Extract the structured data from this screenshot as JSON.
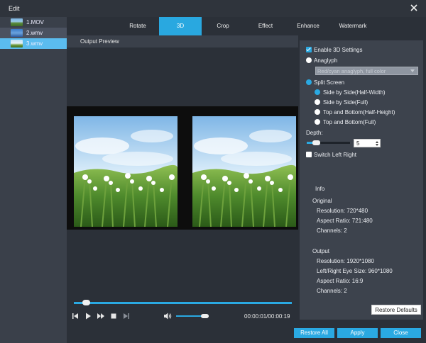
{
  "window": {
    "title": "Edit"
  },
  "files": [
    {
      "name": "1.MOV",
      "selected": false
    },
    {
      "name": "2.wmv",
      "selected": false
    },
    {
      "name": "3.wmv",
      "selected": true
    }
  ],
  "tabs": [
    "Rotate",
    "3D",
    "Crop",
    "Effect",
    "Enhance",
    "Watermark"
  ],
  "active_tab": "3D",
  "preview": {
    "label": "Output Preview",
    "time": "00:00:01/00:00:19"
  },
  "settings": {
    "enable_3d": {
      "label": "Enable 3D Settings",
      "checked": true
    },
    "anaglyph": {
      "label": "Anaglyph",
      "selected": false,
      "dropdown_value": "Red/cyan anaglyph, full color"
    },
    "split_screen": {
      "label": "Split Screen",
      "selected": true
    },
    "split_options": [
      {
        "label": "Side by Side(Half-Width)",
        "selected": true
      },
      {
        "label": "Side by Side(Full)",
        "selected": false
      },
      {
        "label": "Top and Bottom(Half-Height)",
        "selected": false
      },
      {
        "label": "Top and Bottom(Full)",
        "selected": false
      }
    ],
    "depth": {
      "label": "Depth:",
      "value": "5"
    },
    "switch_left_right": {
      "label": "Switch Left Right",
      "checked": false
    }
  },
  "info": {
    "heading": "Info",
    "original": {
      "heading": "Original",
      "resolution": "Resolution: 720*480",
      "aspect_ratio": "Aspect Ratio: 721:480",
      "channels": "Channels: 2"
    },
    "output": {
      "heading": "Output",
      "resolution": "Resolution: 1920*1080",
      "eye_size": "Left/Right Eye Size: 960*1080",
      "aspect_ratio": "Aspect Ratio: 16:9",
      "channels": "Channels: 2"
    }
  },
  "buttons": {
    "restore_defaults": "Restore Defaults",
    "restore_all": "Restore All",
    "apply": "Apply",
    "close": "Close"
  },
  "colors": {
    "accent": "#2aa9e2",
    "background": "#2b3038",
    "panel": "#3d434d"
  },
  "icons": {
    "close": "close-icon",
    "prev": "skip-previous-icon",
    "play": "play-icon",
    "next_frame": "next-frame-icon",
    "stop": "stop-icon",
    "next": "skip-next-icon",
    "volume": "volume-icon"
  }
}
